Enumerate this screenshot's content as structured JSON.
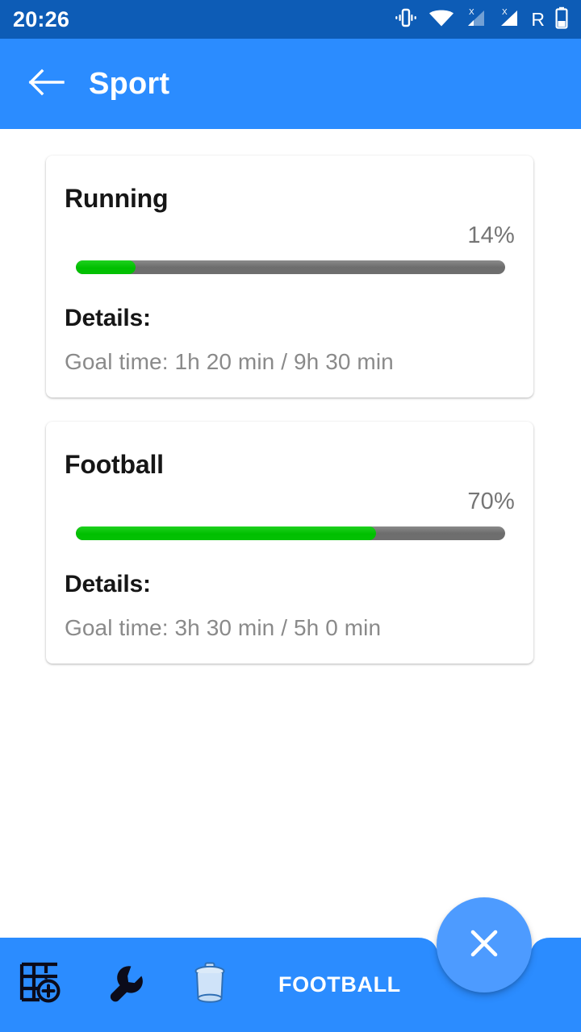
{
  "status_bar": {
    "clock": "20:26",
    "roaming_label": "R",
    "icons": [
      "vibrate-icon",
      "wifi-icon",
      "signal-no-sim-1-icon",
      "signal-no-sim-2-icon",
      "roaming-icon",
      "battery-icon"
    ],
    "background_color": "#0D5CB6"
  },
  "app_bar": {
    "title": "Sport",
    "back_icon": "arrow-left-icon",
    "background_color": "#2B8CFF",
    "text_color": "#FFFFFF"
  },
  "theme": {
    "accent": "#2B8CFF",
    "progress_fill": "#00C000",
    "progress_track": "#6F6F6F",
    "page_background": "#FFFFFF",
    "muted_text": "#8A8A8A"
  },
  "cards": [
    {
      "title": "Running",
      "percent_label": "14%",
      "percent_value": 14,
      "details_label": "Details:",
      "details_value": "Goal time: 1h 20 min / 9h 30 min"
    },
    {
      "title": "Football",
      "percent_label": "70%",
      "percent_value": 70,
      "details_label": "Details:",
      "details_value": "Goal time: 3h 30 min / 5h 0 min"
    }
  ],
  "bottom_bar": {
    "background_color": "#2B8CFF",
    "items": [
      {
        "icon": "add-grid-icon",
        "label": ""
      },
      {
        "icon": "wrench-icon",
        "label": ""
      },
      {
        "icon": "trash-icon",
        "label": ""
      }
    ],
    "label": "FOOTBALL"
  },
  "fab": {
    "icon": "close-icon",
    "background_color": "#4D9BFF"
  }
}
